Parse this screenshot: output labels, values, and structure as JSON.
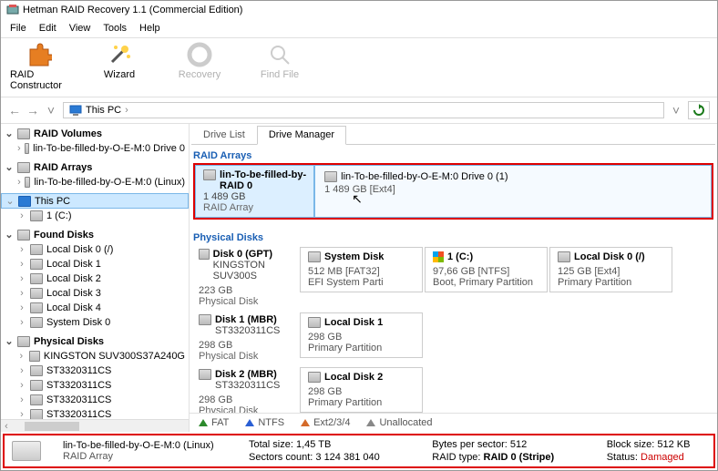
{
  "window": {
    "title": "Hetman RAID Recovery 1.1 (Commercial Edition)"
  },
  "menu": [
    "File",
    "Edit",
    "View",
    "Tools",
    "Help"
  ],
  "toolbar": [
    {
      "label": "RAID Constructor",
      "disabled": false,
      "icon": "puzzle"
    },
    {
      "label": "Wizard",
      "disabled": false,
      "icon": "wand"
    },
    {
      "label": "Recovery",
      "disabled": true,
      "icon": "lifebuoy"
    },
    {
      "label": "Find File",
      "disabled": true,
      "icon": "magnifier"
    }
  ],
  "nav": {
    "location": "This PC"
  },
  "tree": {
    "groups": [
      {
        "label": "RAID Volumes",
        "items": [
          {
            "label": "lin-To-be-filled-by-O-E-M:0 Drive 0"
          }
        ]
      },
      {
        "label": "RAID Arrays",
        "items": [
          {
            "label": "lin-To-be-filled-by-O-E-M:0 (Linux)"
          }
        ]
      },
      {
        "label": "This PC",
        "selected": true,
        "items": [
          {
            "label": "1 (C:)"
          }
        ]
      },
      {
        "label": "Found Disks",
        "items": [
          {
            "label": "Local Disk 0 (/)"
          },
          {
            "label": "Local Disk 1"
          },
          {
            "label": "Local Disk 2"
          },
          {
            "label": "Local Disk 3"
          },
          {
            "label": "Local Disk 4"
          },
          {
            "label": "System Disk 0"
          }
        ]
      },
      {
        "label": "Physical Disks",
        "items": [
          {
            "label": "KINGSTON SUV300S37A240G"
          },
          {
            "label": "ST3320311CS"
          },
          {
            "label": "ST3320311CS"
          },
          {
            "label": "ST3320311CS"
          },
          {
            "label": "ST3320311CS"
          }
        ]
      }
    ]
  },
  "tabs": {
    "inactive": "Drive List",
    "active": "Drive Manager"
  },
  "sections": {
    "raid": "RAID Arrays",
    "phys": "Physical Disks"
  },
  "raid_card": {
    "name": "lin-To-be-filled-by-",
    "raid": "RAID 0",
    "size": "1 489 GB",
    "type": "RAID Array",
    "part_name": "lin-To-be-filled-by-O-E-M:0 Drive 0 (1)",
    "part_size": "1 489 GB [Ext4]"
  },
  "disks": [
    {
      "name": "Disk 0 (GPT)",
      "model": "KINGSTON SUV300S",
      "size": "223 GB",
      "type": "Physical Disk",
      "parts": [
        {
          "name": "System Disk",
          "size": "512 MB [FAT32]",
          "desc": "EFI System Parti",
          "icon": "system"
        },
        {
          "name": "1 (C:)",
          "size": "97,66 GB [NTFS]",
          "desc": "Boot, Primary Partition",
          "icon": "win"
        },
        {
          "name": "Local Disk 0 (/)",
          "size": "125 GB [Ext4]",
          "desc": "Primary Partition",
          "icon": "local"
        }
      ]
    },
    {
      "name": "Disk 1 (MBR)",
      "model": "ST3320311CS",
      "size": "298 GB",
      "type": "Physical Disk",
      "parts": [
        {
          "name": "Local Disk 1",
          "size": "298 GB",
          "desc": "Primary Partition",
          "icon": "local"
        }
      ]
    },
    {
      "name": "Disk 2 (MBR)",
      "model": "ST3320311CS",
      "size": "298 GB",
      "type": "Physical Disk",
      "parts": [
        {
          "name": "Local Disk 2",
          "size": "298 GB",
          "desc": "Primary Partition",
          "icon": "local"
        }
      ]
    }
  ],
  "legend": {
    "fat": "FAT",
    "ntfs": "NTFS",
    "ext": "Ext2/3/4",
    "unalloc": "Unallocated"
  },
  "status": {
    "name": "lin-To-be-filled-by-O-E-M:0 (Linux)",
    "type": "RAID Array",
    "total_lbl": "Total size:",
    "total_val": "1,45 TB",
    "bytes_lbl": "Bytes per sector:",
    "bytes_val": "512",
    "block_lbl": "Block size:",
    "block_val": "512 KB",
    "sectors_lbl": "Sectors count:",
    "sectors_val": "3 124 381 040",
    "rtype_lbl": "RAID type:",
    "rtype_val": "RAID 0 (Stripe)",
    "status_lbl": "Status:",
    "status_val": "Damaged"
  }
}
